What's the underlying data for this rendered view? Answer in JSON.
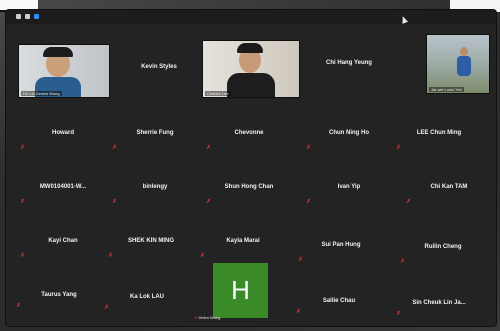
{
  "participants": [
    {
      "name": "Ho Lei Dennis Wong",
      "type": "video"
    },
    {
      "name": "Kevin Styles",
      "type": "name"
    },
    {
      "name": "Charles Lee",
      "type": "video"
    },
    {
      "name": "Chi Hang Yeung",
      "type": "name"
    },
    {
      "name": "Jai-wei Louis Yeh",
      "type": "video"
    },
    {
      "name": "Howard",
      "type": "name"
    },
    {
      "name": "Sherrie Fung",
      "type": "name"
    },
    {
      "name": "Chevonne",
      "type": "name"
    },
    {
      "name": "Chun Ning Ho",
      "type": "name"
    },
    {
      "name": "LEE Chun Ming",
      "type": "name"
    },
    {
      "name": "MW0104001-W...",
      "type": "name"
    },
    {
      "name": "binlengy",
      "type": "name"
    },
    {
      "name": "Shun Hong Chan",
      "type": "name"
    },
    {
      "name": "Ivan Yip",
      "type": "name"
    },
    {
      "name": "Chi Kan TAM",
      "type": "name"
    },
    {
      "name": "Kayi Chan",
      "type": "name"
    },
    {
      "name": "SHEK KIN MING",
      "type": "name"
    },
    {
      "name": "Kayla Marai",
      "type": "name"
    },
    {
      "name": "Sui Pan Hung",
      "type": "name"
    },
    {
      "name": "Ruilin Cheng",
      "type": "name"
    },
    {
      "name": "Taurus Yang",
      "type": "name"
    },
    {
      "name": "Ka Lok LAU",
      "type": "name"
    },
    {
      "name": "Helen Wong",
      "type": "avatar",
      "initial": "H"
    },
    {
      "name": "Sallie Chau",
      "type": "name"
    },
    {
      "name": "Sin Cheuk Lin Ja...",
      "type": "name"
    }
  ],
  "colors": {
    "muted_mic": "#e33333",
    "avatar_bg": "#3a8a2a",
    "accent": "#2d8cff"
  }
}
